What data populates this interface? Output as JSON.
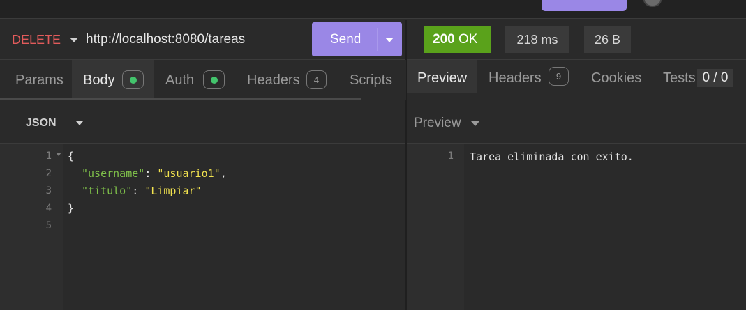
{
  "request": {
    "method": "DELETE",
    "url": "http://localhost:8080/tareas",
    "send_label": "Send"
  },
  "response": {
    "status_code": "200",
    "status_text": "OK",
    "time": "218 ms",
    "size": "26 B"
  },
  "left_tabs": [
    {
      "label": "Params"
    },
    {
      "label": "Body"
    },
    {
      "label": "Auth"
    },
    {
      "label": "Headers",
      "count": "4"
    },
    {
      "label": "Scripts"
    }
  ],
  "right_tabs": [
    {
      "label": "Preview"
    },
    {
      "label": "Headers",
      "count": "9"
    },
    {
      "label": "Cookies"
    },
    {
      "label": "Tests",
      "count": "0 / 0"
    }
  ],
  "body_toolbar": {
    "format": "JSON"
  },
  "preview_toolbar": {
    "mode": "Preview"
  },
  "body_editor": {
    "lines": [
      {
        "num": "1",
        "brace": "{"
      },
      {
        "num": "2",
        "key": "\"username\"",
        "sep": ": ",
        "value": "\"usuario1\"",
        "end": ","
      },
      {
        "num": "3",
        "key": "\"titulo\"",
        "sep": ": ",
        "value": "\"Limpiar\"",
        "end": ""
      },
      {
        "num": "4",
        "brace": "}"
      },
      {
        "num": "5"
      }
    ]
  },
  "preview_editor": {
    "lines": [
      {
        "num": "1",
        "text": "Tarea eliminada con exito."
      }
    ]
  },
  "colors": {
    "accent": "#9a87e6",
    "status_ok": "#5aa21b",
    "method_delete": "#e25b5b",
    "json_key": "#7fc04a",
    "json_string": "#f2e34f",
    "badge_dot": "#43c46c"
  },
  "icons": {
    "method_dropdown": "chevron-down-icon",
    "send_dropdown": "chevron-down-icon",
    "format_dropdown": "chevron-down-icon",
    "preview_dropdown": "chevron-down-icon",
    "fold": "fold-arrow-icon"
  }
}
